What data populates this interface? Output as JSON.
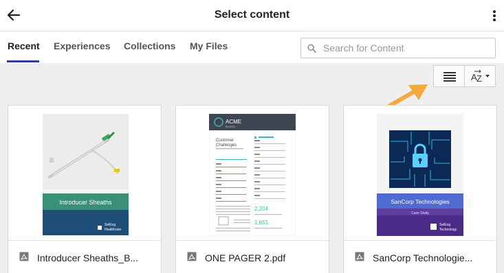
{
  "header": {
    "title": "Select content",
    "back_icon": "arrow-left-icon",
    "more_icon": "more-vertical-icon"
  },
  "tabs": [
    {
      "label": "Recent",
      "active": true
    },
    {
      "label": "Experiences",
      "active": false
    },
    {
      "label": "Collections",
      "active": false
    },
    {
      "label": "My Files",
      "active": false
    }
  ],
  "search": {
    "placeholder": "Search for Content",
    "value": ""
  },
  "toolbar": {
    "list_view_icon": "list-view-icon",
    "sort_icon": "sort-az-icon"
  },
  "colors": {
    "accent": "#2c3e8f",
    "arrow": "#f5a83b",
    "background": "#efefef"
  },
  "cards": [
    {
      "name": "Introducer Sheaths_B...",
      "file_icon": "pdf-file-icon",
      "thumbnail": {
        "banner": "Introducer Sheaths",
        "brand_line1": "SelEng",
        "brand_line2": "Healthcare"
      }
    },
    {
      "name": "ONE PAGER 2.pdf",
      "file_icon": "pdf-file-icon",
      "thumbnail": {
        "logo": "ACME",
        "logo_sub": "PLASTIC",
        "heading_line1": "Customer",
        "heading_line2": "Challenges",
        "big_number_1": "2,204",
        "big_number_2": "1,651"
      }
    },
    {
      "name": "SanCorp Technologie...",
      "file_icon": "pdf-file-icon",
      "thumbnail": {
        "banner": "SanCorp Technologies",
        "subbanner": "Case Study",
        "brand_line1": "SelEng",
        "brand_line2": "Technology"
      }
    }
  ]
}
